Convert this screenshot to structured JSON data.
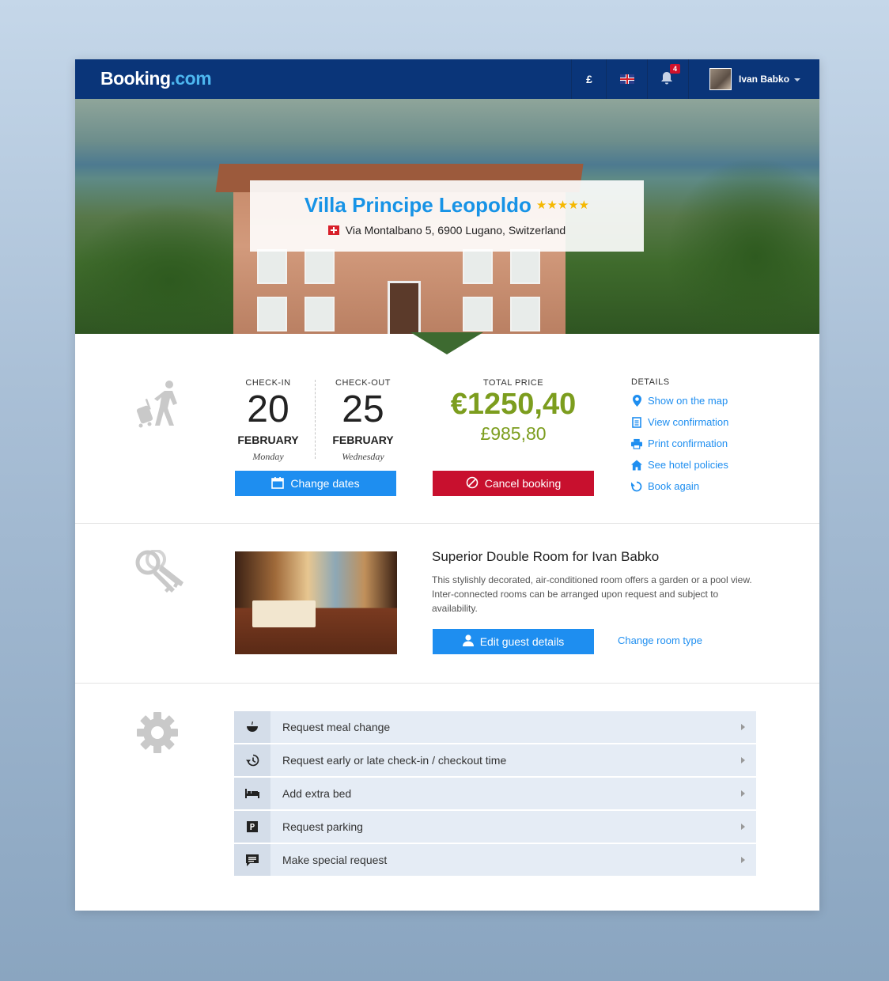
{
  "header": {
    "logo_main": "Booking",
    "logo_suffix": ".com",
    "currency": "£",
    "notification_count": "4",
    "user_name": "Ivan Babko"
  },
  "hotel": {
    "name": "Villa Principe Leopoldo",
    "stars": "★★★★★",
    "address": "Via Montalbano 5, 6900 Lugano, Switzerland"
  },
  "booking": {
    "checkin_label": "CHECK-IN",
    "checkin_day": "20",
    "checkin_month": "FEBRUARY",
    "checkin_weekday": "Monday",
    "checkout_label": "CHECK-OUT",
    "checkout_day": "25",
    "checkout_month": "FEBRUARY",
    "checkout_weekday": "Wednesday",
    "change_dates": "Change dates",
    "total_price_label": "TOTAL PRICE",
    "price_eur": "€1250,40",
    "price_gbp": "£985,80",
    "cancel": "Cancel booking"
  },
  "details": {
    "label": "DETAILS",
    "links": [
      {
        "label": "Show on the map",
        "icon": "map-pin-icon"
      },
      {
        "label": "View confirmation",
        "icon": "document-icon"
      },
      {
        "label": "Print confirmation",
        "icon": "printer-icon"
      },
      {
        "label": "See hotel policies",
        "icon": "home-icon"
      },
      {
        "label": "Book again",
        "icon": "refresh-icon"
      }
    ]
  },
  "room": {
    "title": "Superior Double Room for Ivan Babko",
    "description": "This stylishly decorated, air-conditioned room offers a garden or a pool view. Inter-connected rooms can be arranged upon request and subject to availability.",
    "edit_guest": "Edit guest details",
    "change_room": "Change room type"
  },
  "requests": [
    {
      "label": "Request meal change",
      "icon": "meal-icon"
    },
    {
      "label": "Request early or late check-in / checkout time",
      "icon": "clock-history-icon"
    },
    {
      "label": "Add extra bed",
      "icon": "bed-icon"
    },
    {
      "label": "Request parking",
      "icon": "parking-icon"
    },
    {
      "label": "Make special request",
      "icon": "chat-icon"
    }
  ],
  "colors": {
    "brand": "#0a3579",
    "accent_blue": "#1e8ef0",
    "price_green": "#7c9d1e",
    "cancel_red": "#c8102e"
  }
}
